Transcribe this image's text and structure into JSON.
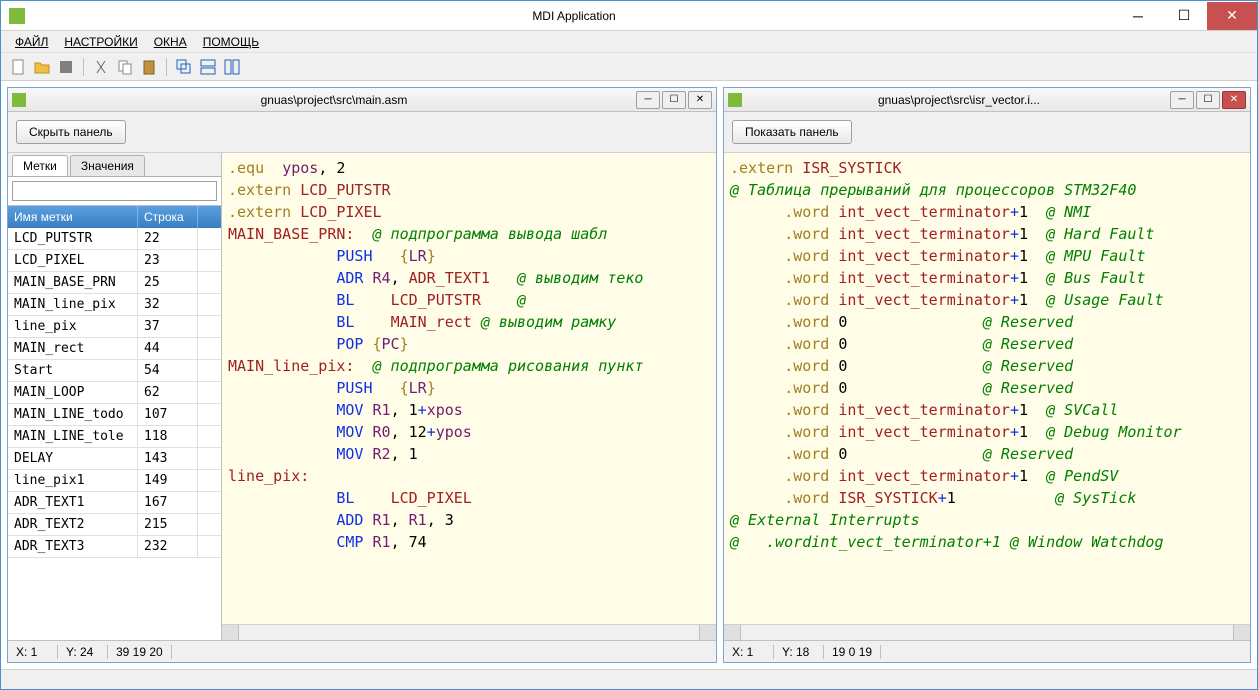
{
  "app": {
    "title": "MDI Application"
  },
  "menu": {
    "file": "ФАЙЛ",
    "settings": "НАСТРОЙКИ",
    "windows": "ОКНА",
    "help": "ПОМОЩЬ"
  },
  "child1": {
    "title": "gnuas\\project\\src\\main.asm",
    "panel_btn": "Скрыть панель",
    "tabs": {
      "labels": "Метки",
      "values": "Значения"
    },
    "table_headers": {
      "name": "Имя метки",
      "line": "Строка"
    },
    "labels": [
      {
        "name": "LCD_PUTSTR",
        "line": "22"
      },
      {
        "name": "LCD_PIXEL",
        "line": "23"
      },
      {
        "name": "MAIN_BASE_PRN",
        "line": "25"
      },
      {
        "name": "MAIN_line_pix",
        "line": "32"
      },
      {
        "name": "line_pix",
        "line": "37"
      },
      {
        "name": "MAIN_rect",
        "line": "44"
      },
      {
        "name": "Start",
        "line": "54"
      },
      {
        "name": "MAIN_LOOP",
        "line": "62"
      },
      {
        "name": "MAIN_LINE_todo",
        "line": "107"
      },
      {
        "name": "MAIN_LINE_tole",
        "line": "118"
      },
      {
        "name": "DELAY",
        "line": "143"
      },
      {
        "name": "line_pix1",
        "line": "149"
      },
      {
        "name": "ADR_TEXT1",
        "line": "167"
      },
      {
        "name": "ADR_TEXT2",
        "line": "215"
      },
      {
        "name": "ADR_TEXT3",
        "line": "232"
      }
    ],
    "status": {
      "x": "X: 1",
      "y": "Y: 24",
      "sel": "39 19 20"
    }
  },
  "child2": {
    "title": "gnuas\\project\\src\\isr_vector.i...",
    "panel_btn": "Показать панель",
    "status": {
      "x": "X: 1",
      "y": "Y: 18",
      "sel": "19 0 19"
    }
  },
  "code1": {
    "l1_dir": ".equ  ",
    "l1_id": "ypos",
    "l1_rest": ", 2",
    "l3_dir": ".extern ",
    "l3_id": "LCD_PUTSTR",
    "l4_dir": ".extern ",
    "l4_id": "LCD_PIXEL",
    "l6_lbl": "MAIN_BASE_PRN:",
    "l6_cmt": "  @ подпрограмма вывода шабл",
    "l7_op": "            PUSH   ",
    "l7_b1": "{",
    "l7_reg": "LR",
    "l7_b2": "}",
    "l8_op": "            ADR ",
    "l8_reg": "R4",
    "l8_mid": ", ",
    "l8_id": "ADR_TEXT1",
    "l8_cmt": "   @ выводим теко",
    "l9_op": "            BL    ",
    "l9_id": "LCD_PUTSTR",
    "l9_cmt": "    @",
    "l10_op": "            BL    ",
    "l10_id": "MAIN_rect",
    "l10_cmt": " @ выводим рамку",
    "l11_op": "            POP ",
    "l11_b1": "{",
    "l11_reg": "PC",
    "l11_b2": "}",
    "l13_lbl": "MAIN_line_pix:",
    "l13_cmt": "  @ подпрограмма рисования пункт",
    "l14_op": "            PUSH   ",
    "l14_b1": "{",
    "l14_reg": "LR",
    "l14_b2": "}",
    "l15_op": "            MOV ",
    "l15_reg": "R1",
    "l15_mid": ", 1",
    "l15_plus": "+",
    "l15_id": "xpos",
    "l16_op": "            MOV ",
    "l16_reg": "R0",
    "l16_mid": ", 12",
    "l16_plus": "+",
    "l16_id": "ypos",
    "l17_op": "            MOV ",
    "l17_reg": "R2",
    "l17_rest": ", 1",
    "l18_lbl": "line_pix:",
    "l20_op": "            BL    ",
    "l20_id": "LCD_PIXEL",
    "l21_op": "            ADD ",
    "l21_r1": "R1",
    "l21_mid": ", ",
    "l21_r2": "R1",
    "l21_rest": ", 3",
    "l22_op": "            CMP ",
    "l22_reg": "R1",
    "l22_rest": ", 74"
  },
  "code2": {
    "l1_dir": ".extern ",
    "l1_id": "ISR_SYSTICK",
    "l2_cmt": "@ Таблица прерываний для процессоров STM32F40",
    "rows": [
      {
        "dir": ".word",
        "id": "int_vect_terminator",
        "plus": "+",
        "num": "1",
        "cmt": "  @ NMI"
      },
      {
        "dir": ".word",
        "id": "int_vect_terminator",
        "plus": "+",
        "num": "1",
        "cmt": "  @ Hard Fault"
      },
      {
        "dir": ".word",
        "id": "int_vect_terminator",
        "plus": "+",
        "num": "1",
        "cmt": "  @ MPU Fault"
      },
      {
        "dir": ".word",
        "id": "int_vect_terminator",
        "plus": "+",
        "num": "1",
        "cmt": "  @ Bus Fault"
      },
      {
        "dir": ".word",
        "id": "int_vect_terminator",
        "plus": "+",
        "num": "1",
        "cmt": "  @ Usage Fault"
      },
      {
        "dir": ".word",
        "id": "0",
        "plus": "",
        "num": "",
        "cmt": "               @ Reserved"
      },
      {
        "dir": ".word",
        "id": "0",
        "plus": "",
        "num": "",
        "cmt": "               @ Reserved"
      },
      {
        "dir": ".word",
        "id": "0",
        "plus": "",
        "num": "",
        "cmt": "               @ Reserved"
      },
      {
        "dir": ".word",
        "id": "0",
        "plus": "",
        "num": "",
        "cmt": "               @ Reserved"
      },
      {
        "dir": ".word",
        "id": "int_vect_terminator",
        "plus": "+",
        "num": "1",
        "cmt": "  @ SVCall"
      },
      {
        "dir": ".word",
        "id": "int_vect_terminator",
        "plus": "+",
        "num": "1",
        "cmt": "  @ Debug Monitor"
      },
      {
        "dir": ".word",
        "id": "0",
        "plus": "",
        "num": "",
        "cmt": "               @ Reserved"
      },
      {
        "dir": ".word",
        "id": "int_vect_terminator",
        "plus": "+",
        "num": "1",
        "cmt": "  @ PendSV"
      },
      {
        "dir": ".word",
        "id": "ISR_SYSTICK",
        "plus": "+",
        "num": "1",
        "cmt": "           @ SysTick"
      }
    ],
    "l_ext_cmt": "@ External Interrupts",
    "l_last_cmt": "@   .wordint_vect_terminator+1 @ Window Watchdog"
  }
}
